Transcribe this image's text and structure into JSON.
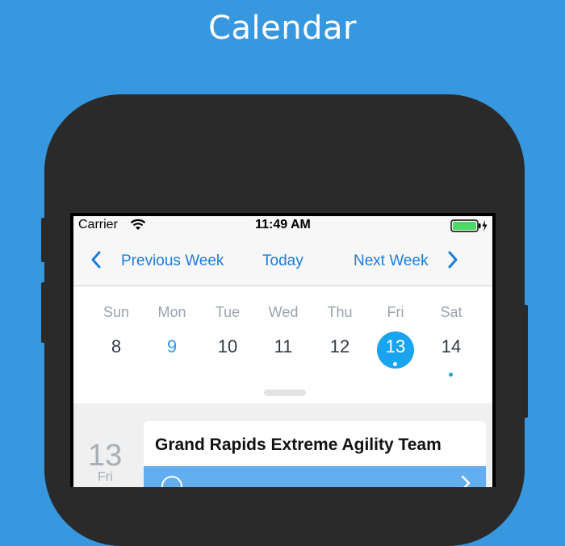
{
  "page": {
    "title": "Calendar"
  },
  "status_bar": {
    "carrier": "Carrier",
    "time": "11:49 AM",
    "wifi_icon": "wifi-icon",
    "battery_icon": "battery-icon"
  },
  "week_nav": {
    "previous_label": "Previous Week",
    "today_label": "Today",
    "next_label": "Next Week",
    "accent_color": "#1A7CE0"
  },
  "week": {
    "days": [
      {
        "name": "Sun",
        "num": "8",
        "state": "normal",
        "has_event": false
      },
      {
        "name": "Mon",
        "num": "9",
        "state": "today",
        "has_event": false
      },
      {
        "name": "Tue",
        "num": "10",
        "state": "normal",
        "has_event": false
      },
      {
        "name": "Wed",
        "num": "11",
        "state": "normal",
        "has_event": false
      },
      {
        "name": "Thu",
        "num": "12",
        "state": "normal",
        "has_event": false
      },
      {
        "name": "Fri",
        "num": "13",
        "state": "selected",
        "has_event": true
      },
      {
        "name": "Sat",
        "num": "14",
        "state": "normal",
        "has_event": true
      }
    ],
    "selected_color": "#1AA4F0"
  },
  "events": {
    "date_num": "13",
    "date_day": "Fri",
    "items": [
      {
        "title": "Grand Rapids Extreme Agility Team"
      }
    ]
  },
  "colors": {
    "background": "#3797DF",
    "phone": "#2a2a2a"
  }
}
